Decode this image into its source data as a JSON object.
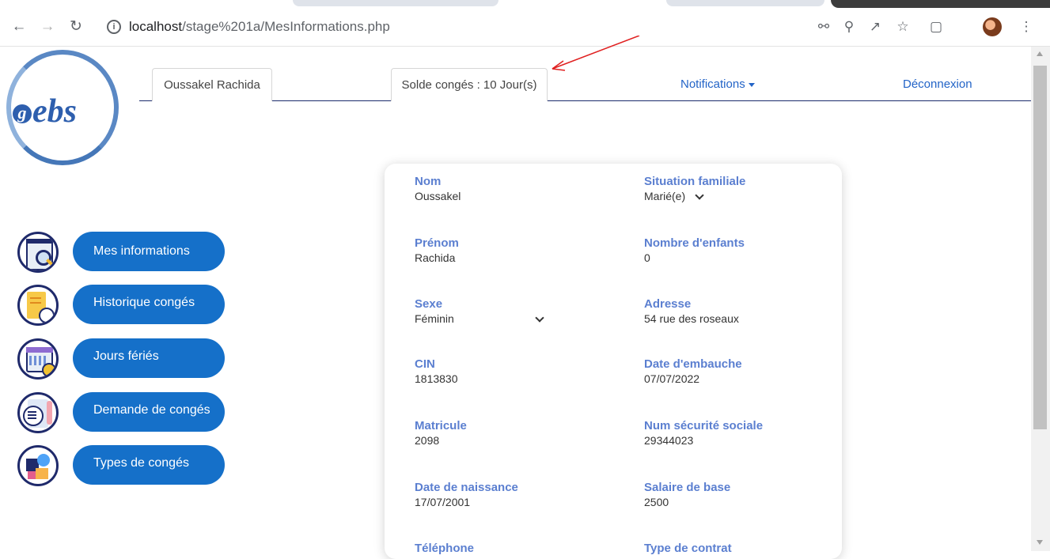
{
  "browser": {
    "url_host": "localhost",
    "url_path": "/stage%201a/MesInformations.php"
  },
  "logo": {
    "text": "ebs"
  },
  "topnav": {
    "user_name": "Oussakel Rachida",
    "solde": "Solde congés : 10 Jour(s)",
    "notifications": "Notifications",
    "logout": "Déconnexion"
  },
  "sidebar": {
    "items": [
      {
        "label": "Mes informations",
        "icon": "magnifier-document-icon"
      },
      {
        "label": "Historique congés",
        "icon": "clock-notepad-icon"
      },
      {
        "label": "Jours fériés",
        "icon": "calendar-check-icon"
      },
      {
        "label": "Demande de congés",
        "icon": "list-document-icon"
      },
      {
        "label": "Types de congés",
        "icon": "puzzle-icon"
      }
    ]
  },
  "info": {
    "nom": {
      "label": "Nom",
      "value": "Oussakel"
    },
    "prenom": {
      "label": "Prénom",
      "value": "Rachida"
    },
    "sexe": {
      "label": "Sexe",
      "value": "Féminin"
    },
    "cin": {
      "label": "CIN",
      "value": "1813830"
    },
    "matricule": {
      "label": "Matricule",
      "value": "2098"
    },
    "naissance": {
      "label": "Date de naissance",
      "value": "17/07/2001"
    },
    "telephone": {
      "label": "Téléphone"
    },
    "situation": {
      "label": "Situation familiale",
      "value": "Marié(e)"
    },
    "enfants": {
      "label": "Nombre d'enfants",
      "value": "0"
    },
    "adresse": {
      "label": "Adresse",
      "value": "54 rue des roseaux"
    },
    "embauche": {
      "label": "Date d'embauche",
      "value": "07/07/2022"
    },
    "secu": {
      "label": "Num sécurité sociale",
      "value": "29344023"
    },
    "salaire": {
      "label": "Salaire de base",
      "value": "2500"
    },
    "contrat": {
      "label": "Type de contrat"
    }
  },
  "colors": {
    "accent": "#1570c9",
    "label": "#5b7fd0",
    "nav": "#1b2a6b"
  }
}
